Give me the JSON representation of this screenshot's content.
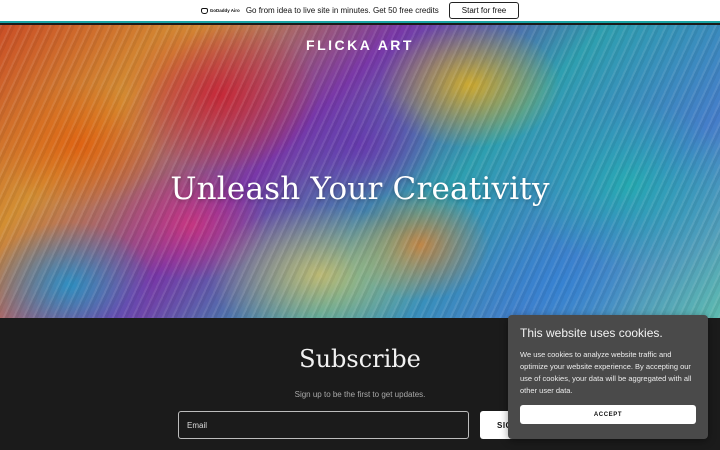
{
  "promo": {
    "logo_text": "GoDaddy Airo",
    "message": "Go from idea to live site in minutes. Get 50 free credits",
    "cta_label": "Start for free"
  },
  "hero": {
    "brand": "FLICKA ART",
    "headline": "Unleash Your Creativity"
  },
  "subscribe": {
    "title": "Subscribe",
    "subtitle": "Sign up to be the first to get updates.",
    "email_placeholder": "Email",
    "button_label": "SIG"
  },
  "cookie": {
    "title": "This website uses cookies.",
    "text": "We use cookies to analyze website traffic and optimize your website experience. By accepting our use of cookies, your data will be aggregated with all other user data.",
    "accept_label": "ACCEPT"
  },
  "colors": {
    "promo_border": "#1aa4a4",
    "subscribe_bg": "#1b1b1b",
    "cookie_bg": "#4a4a4a"
  }
}
